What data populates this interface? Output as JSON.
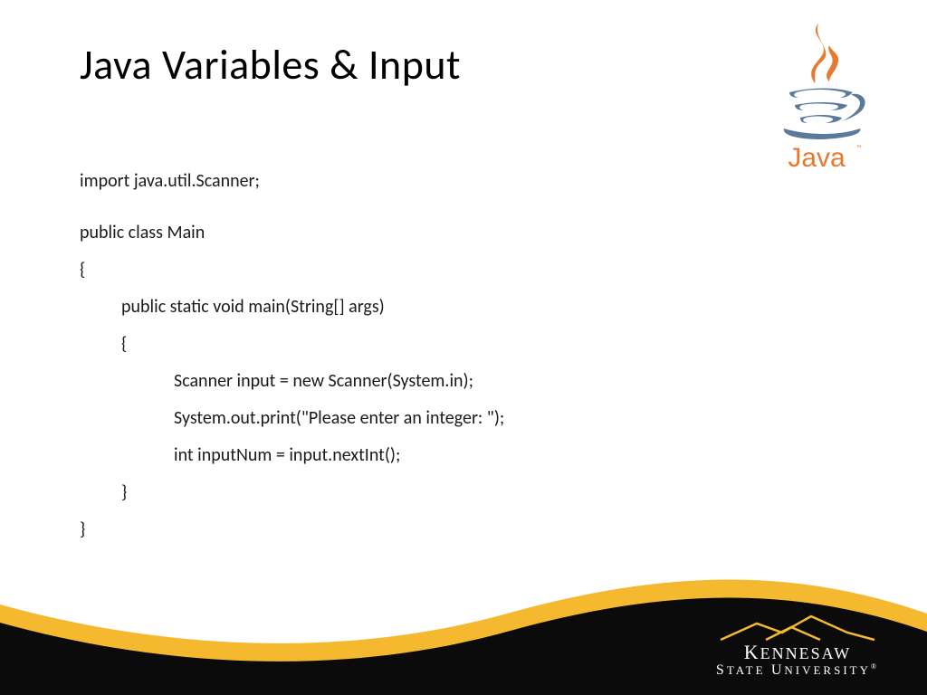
{
  "title": "Java Variables & Input",
  "code": {
    "l0": "import java.util.Scanner;",
    "l1": "public class Main",
    "l2": "{",
    "l3": "public static void main(String[] args)",
    "l4": "{",
    "l5": "Scanner input = new Scanner(System.in);",
    "l6": "System.out.print(\"Please enter an integer: \");",
    "l7": "int inputNum = input.nextInt();",
    "l8": "}",
    "l9": "}"
  },
  "logos": {
    "java_wordmark": "Java",
    "ksu_line1": "KENNESAW",
    "ksu_line2": "STATE UNIVERSITY"
  },
  "colors": {
    "java_orange": "#e8792e",
    "java_blue": "#5a7a9c",
    "ksu_gold": "#f4b92e",
    "ksu_black": "#0b0b0b"
  }
}
